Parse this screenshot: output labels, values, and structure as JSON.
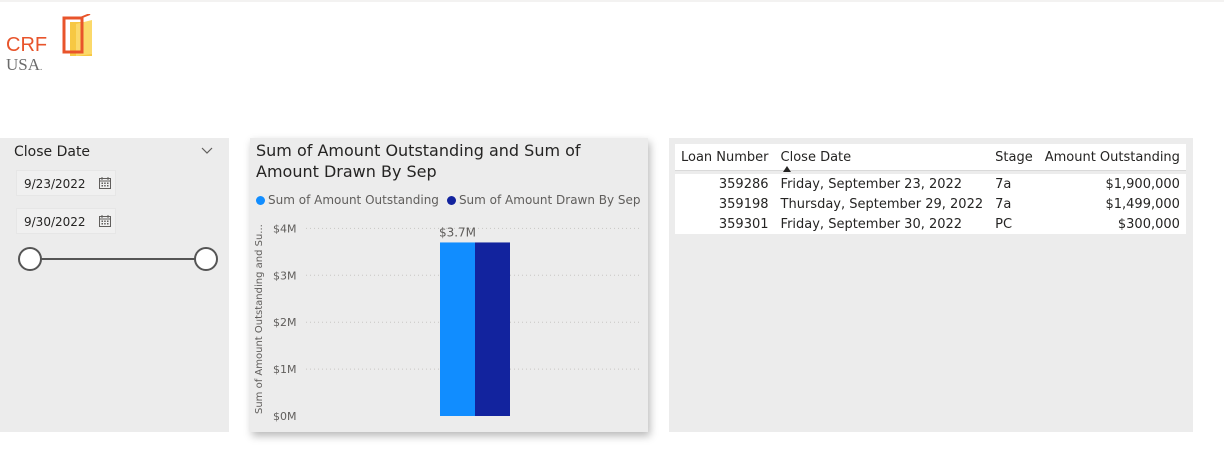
{
  "logo": {
    "line1": "CRF",
    "line2": "USA",
    "trademark": "."
  },
  "slicer": {
    "title": "Close Date",
    "start_date": "9/23/2022",
    "end_date": "9/30/2022",
    "range_fraction_start": 0,
    "range_fraction_end": 1
  },
  "chart": {
    "title": "Sum of Amount Outstanding and Sum of Amount Drawn By Sep",
    "ylabel": "Sum of Amount Outstanding and Su...",
    "data_label": "$3.7M"
  },
  "chart_data": {
    "type": "bar",
    "categories": [
      ""
    ],
    "series": [
      {
        "name": "Sum of Amount Outstanding",
        "values": [
          3.7
        ],
        "color": "#118DFF"
      },
      {
        "name": "Sum of Amount Drawn By Sep",
        "values": [
          3.7
        ],
        "color": "#12239E"
      }
    ],
    "y_ticks": [
      "$0M",
      "$1M",
      "$2M",
      "$3M",
      "$4M"
    ],
    "ylim": [
      0,
      4.2
    ],
    "grid": true,
    "legend_position": "top-left"
  },
  "table": {
    "columns": [
      "Loan Number",
      "Close Date",
      "Stage",
      "Amount Outstanding"
    ],
    "rows": [
      {
        "loan": "359286",
        "date": "Friday, September 23, 2022",
        "stage": "7a",
        "amount": "$1,900,000"
      },
      {
        "loan": "359198",
        "date": "Thursday, September 29, 2022",
        "stage": "7a",
        "amount": "$1,499,000"
      },
      {
        "loan": "359301",
        "date": "Friday, September 30, 2022",
        "stage": "PC",
        "amount": "$300,000"
      }
    ]
  },
  "colors": {
    "accent_logo": "#e8542b",
    "series1": "#118DFF",
    "series2": "#12239E",
    "panel_bg": "#ececec"
  }
}
